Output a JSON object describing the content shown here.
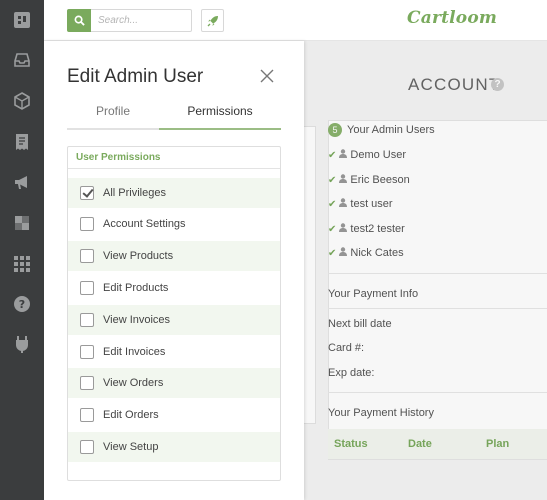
{
  "brand": "Cartloom",
  "search": {
    "placeholder": "Search..."
  },
  "sidebar": {
    "icons": [
      "dashboard-icon",
      "inbox-icon",
      "box-icon",
      "receipt-icon",
      "megaphone-icon",
      "layers-icon",
      "grid-icon",
      "help-icon",
      "plugin-icon"
    ]
  },
  "account": {
    "title": "ACCOUNT",
    "admin_users": {
      "count": "5",
      "heading": "Your Admin Users",
      "users": [
        "Demo User",
        "Eric Beeson",
        "test user",
        "test2 tester",
        "Nick Cates"
      ]
    },
    "payment_info": {
      "heading": "Your Payment Info",
      "rows": [
        "Next bill date",
        "Card #:",
        "Exp date:"
      ]
    },
    "payment_history": {
      "heading": "Your Payment History",
      "columns": [
        "Status",
        "Date",
        "Plan"
      ]
    }
  },
  "modal": {
    "title": "Edit Admin User",
    "tabs": [
      {
        "label": "Profile",
        "active": false
      },
      {
        "label": "Permissions",
        "active": true
      }
    ],
    "permissions_heading": "User Permissions",
    "permissions": [
      {
        "label": "All Privileges",
        "checked": true
      },
      {
        "label": "Account Settings",
        "checked": false
      },
      {
        "label": "View Products",
        "checked": false
      },
      {
        "label": "Edit Products",
        "checked": false
      },
      {
        "label": "View Invoices",
        "checked": false
      },
      {
        "label": "Edit Invoices",
        "checked": false
      },
      {
        "label": "View Orders",
        "checked": false
      },
      {
        "label": "Edit Orders",
        "checked": false
      },
      {
        "label": "View Setup",
        "checked": false
      }
    ]
  },
  "colors": {
    "accent": "#7aaa5d",
    "sidebar": "#3b3d3e",
    "row_alt": "#f2f7ef"
  }
}
